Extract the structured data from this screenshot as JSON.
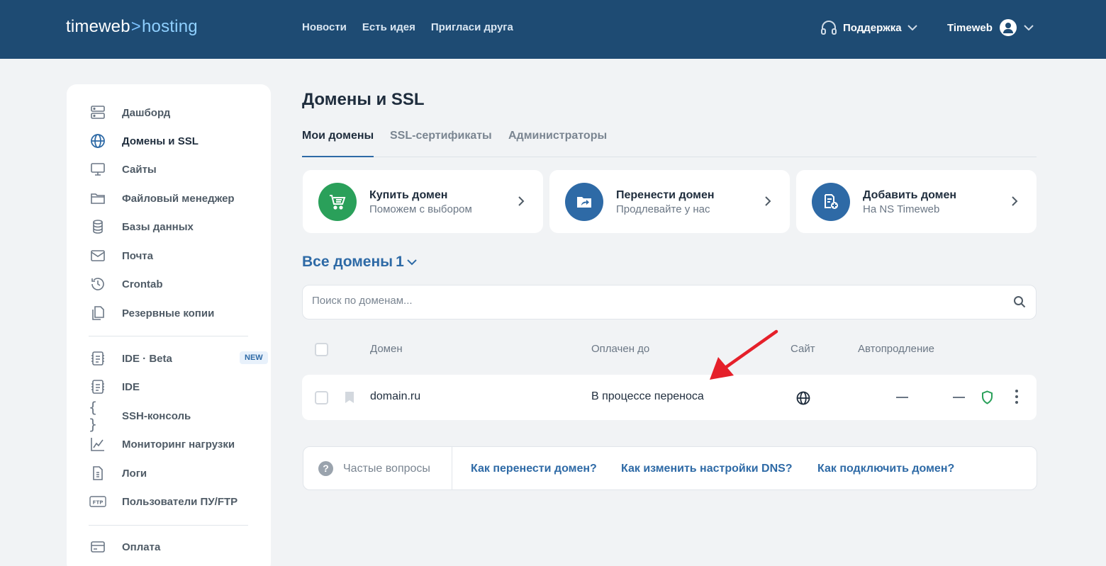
{
  "header": {
    "logo_main": "timeweb",
    "logo_sep": ">",
    "logo_sub": "hosting",
    "nav": [
      "Новости",
      "Есть идея",
      "Пригласи друга"
    ],
    "support_label": "Поддержка",
    "account_label": "Timeweb"
  },
  "sidebar": {
    "items": [
      {
        "label": "Дашборд",
        "icon": "server-icon"
      },
      {
        "label": "Домены и SSL",
        "icon": "globe-icon"
      },
      {
        "label": "Сайты",
        "icon": "monitor-icon"
      },
      {
        "label": "Файловый менеджер",
        "icon": "folder-icon"
      },
      {
        "label": "Базы данных",
        "icon": "database-icon"
      },
      {
        "label": "Почта",
        "icon": "mail-icon"
      },
      {
        "label": "Crontab",
        "icon": "history-icon"
      },
      {
        "label": "Резервные копии",
        "icon": "copy-icon"
      },
      {
        "label": "IDE · Beta",
        "icon": "code-file-icon",
        "badge": "NEW"
      },
      {
        "label": "IDE",
        "icon": "code-file-icon"
      },
      {
        "label": "SSH-консоль",
        "icon": "braces-icon"
      },
      {
        "label": "Мониторинг нагрузки",
        "icon": "chart-icon"
      },
      {
        "label": "Логи",
        "icon": "log-file-icon"
      },
      {
        "label": "Пользователи ПУ/FTP",
        "icon": "ftp-icon"
      },
      {
        "label": "Оплата",
        "icon": "card-icon"
      }
    ]
  },
  "main": {
    "title": "Домены и SSL",
    "tabs": [
      "Мои домены",
      "SSL-сертификаты",
      "Администраторы"
    ],
    "cards": [
      {
        "title": "Купить домен",
        "subtitle": "Поможем с выбором",
        "icon": "cart-icon",
        "color": "#2aa05a"
      },
      {
        "title": "Перенести домен",
        "subtitle": "Продлевайте у нас",
        "icon": "folder-transfer-icon",
        "color": "#2e6aa6"
      },
      {
        "title": "Добавить домен",
        "subtitle": "На NS Timeweb",
        "icon": "add-document-icon",
        "color": "#2e6aa6"
      }
    ],
    "filter_label": "Все домены",
    "filter_count": "1",
    "search_placeholder": "Поиск по доменам...",
    "columns": {
      "domain": "Домен",
      "paid_until": "Оплачен до",
      "site": "Сайт",
      "autorenew": "Автопродление"
    },
    "rows": [
      {
        "domain": "domain.ru",
        "paid_until": "В процессе переноса"
      }
    ]
  },
  "faq": {
    "label": "Частые вопросы",
    "icon_text": "?",
    "links": [
      "Как перенести домен?",
      "Как изменить настройки DNS?",
      "Как подключить домен?"
    ]
  },
  "colors": {
    "header_bg": "#1e4b73",
    "accent": "#2e6aa6",
    "green": "#2aa05a",
    "arrow": "#e5202a"
  }
}
